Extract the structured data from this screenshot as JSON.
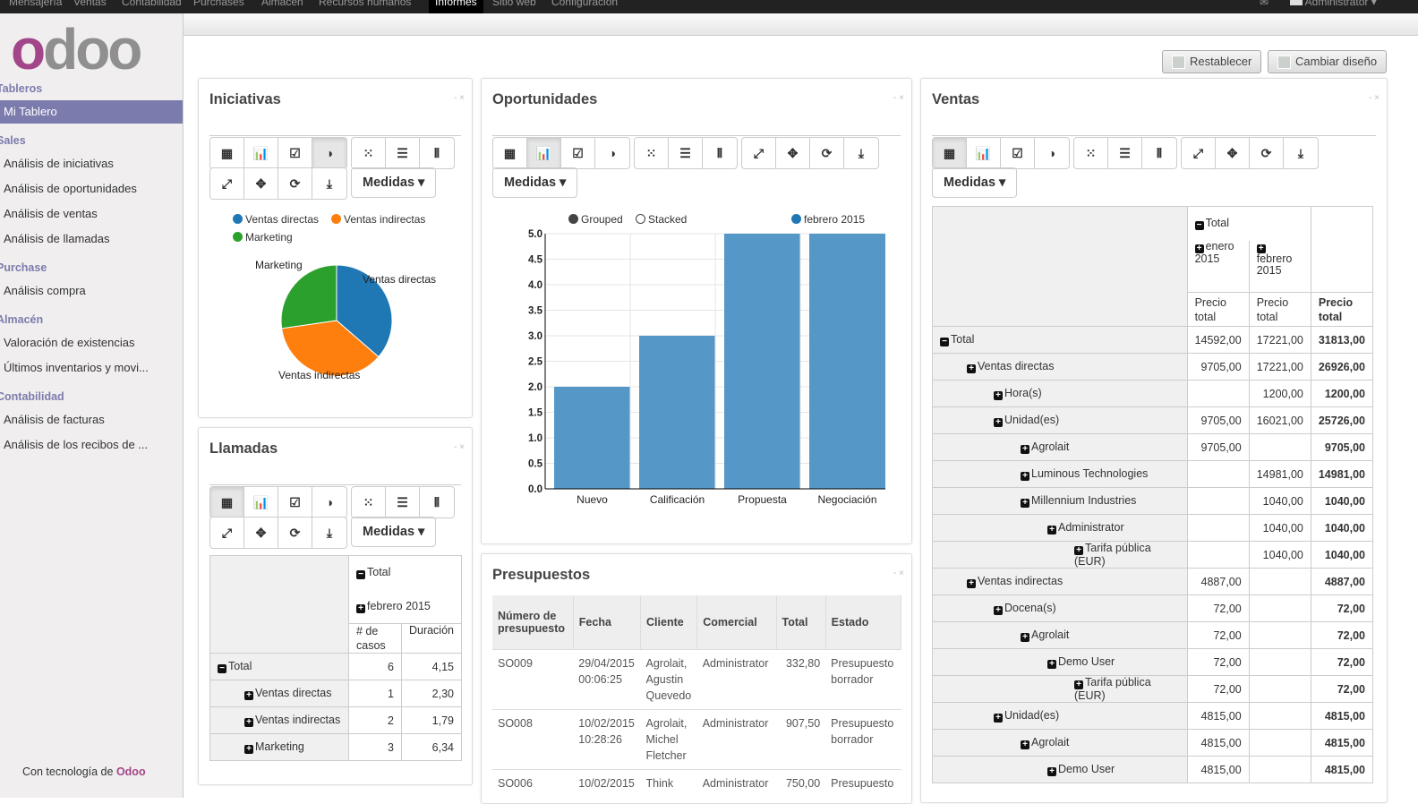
{
  "topnav": {
    "items": [
      "Mensajería",
      "Ventas",
      "Contabilidad",
      "Purchases",
      "Almacén",
      "Recursos humanos",
      "Informes",
      "Sitio web",
      "Configuración"
    ],
    "active": "Informes",
    "user": "Administrator"
  },
  "sidebar": {
    "logo": "odoo",
    "sections": [
      {
        "title": "Tableros",
        "items": [
          "Mi Tablero"
        ]
      },
      {
        "title": "Sales",
        "items": [
          "Análisis de iniciativas",
          "Análisis de oportunidades",
          "Análisis de ventas",
          "Análisis de llamadas"
        ]
      },
      {
        "title": "Purchase",
        "items": [
          "Análisis compra"
        ]
      },
      {
        "title": "Almacén",
        "items": [
          "Valoración de existencias",
          "Últimos inventarios y movi..."
        ]
      },
      {
        "title": "Contabilidad",
        "items": [
          "Análisis de facturas",
          "Análisis de los recibos de ..."
        ]
      }
    ],
    "active": "Mi Tablero",
    "powered_prefix": "Con tecnología de",
    "powered_brand": "Odoo"
  },
  "actions": {
    "reset": "Restablecer",
    "layout": "Cambiar diseño"
  },
  "panel_controls": "- ×",
  "measures_label": "Medidas",
  "colors": {
    "blue": "#1f77b4",
    "orange": "#ff7f0e",
    "green": "#2ca02c",
    "bar": "#5598c8",
    "accent": "#7c7bad",
    "brand": "#a24689"
  },
  "iniciativas": {
    "title": "Iniciativas",
    "active_view": "pie",
    "chart_data": {
      "type": "pie",
      "labels": [
        "Ventas directas",
        "Ventas indirectas",
        "Marketing"
      ],
      "values": [
        4,
        4,
        3
      ],
      "legend": "top"
    }
  },
  "oportunidades": {
    "title": "Oportunidades",
    "active_view": "bar",
    "chart_data": {
      "type": "bar",
      "categories": [
        "Nuevo",
        "Calificación",
        "Propuesta",
        "Negociación"
      ],
      "series": [
        {
          "name": "febrero 2015",
          "values": [
            2,
            3,
            5,
            5
          ]
        }
      ],
      "ylim": [
        0,
        5
      ],
      "yticks": [
        "0.0",
        "0.5",
        "1.0",
        "1.5",
        "2.0",
        "2.5",
        "3.0",
        "3.5",
        "4.0",
        "4.5",
        "5.0"
      ],
      "modes": [
        "Grouped",
        "Stacked"
      ],
      "mode": "Grouped",
      "grid": true
    }
  },
  "llamadas": {
    "title": "Llamadas",
    "active_view": "table",
    "header_total": "Total",
    "header_period": "febrero 2015",
    "col1": "# de casos",
    "col2": "Duración",
    "rows": [
      {
        "label": "Total",
        "expanded": true,
        "indent": 0,
        "v1": "6",
        "v2": "4,15"
      },
      {
        "label": "Ventas directas",
        "indent": 1,
        "v1": "1",
        "v2": "2,30"
      },
      {
        "label": "Ventas indirectas",
        "indent": 1,
        "v1": "2",
        "v2": "1,79"
      },
      {
        "label": "Marketing",
        "indent": 1,
        "v1": "3",
        "v2": "6,34"
      }
    ]
  },
  "presupuestos": {
    "title": "Presupuestos",
    "columns": [
      "Número de presupuesto",
      "Fecha",
      "Cliente",
      "Comercial",
      "Total",
      "Estado"
    ],
    "rows": [
      [
        "SO009",
        "29/04/2015 00:06:25",
        "Agrolait, Agustin Quevedo",
        "Administrator",
        "332,80",
        "Presupuesto borrador"
      ],
      [
        "SO008",
        "10/02/2015 10:28:26",
        "Agrolait, Michel Fletcher",
        "Administrator",
        "907,50",
        "Presupuesto borrador"
      ],
      [
        "SO006",
        "10/02/2015",
        "Think",
        "Administrator",
        "750,00",
        "Presupuesto"
      ]
    ]
  },
  "ventas": {
    "title": "Ventas",
    "active_view": "table",
    "header_total": "Total",
    "periods": [
      "enero 2015",
      "febrero 2015"
    ],
    "measure": "Precio total",
    "rows": [
      {
        "label": "Total",
        "indent": 0,
        "expanded": true,
        "a": "14592,00",
        "b": "17221,00",
        "t": "31813,00"
      },
      {
        "label": "Ventas directas",
        "indent": 1,
        "a": "9705,00",
        "b": "17221,00",
        "t": "26926,00"
      },
      {
        "label": "Hora(s)",
        "indent": 2,
        "a": "",
        "b": "1200,00",
        "t": "1200,00"
      },
      {
        "label": "Unidad(es)",
        "indent": 2,
        "a": "9705,00",
        "b": "16021,00",
        "t": "25726,00"
      },
      {
        "label": "Agrolait",
        "indent": 3,
        "a": "9705,00",
        "b": "",
        "t": "9705,00"
      },
      {
        "label": "Luminous Technologies",
        "indent": 3,
        "a": "",
        "b": "14981,00",
        "t": "14981,00"
      },
      {
        "label": "Millennium Industries",
        "indent": 3,
        "a": "",
        "b": "1040,00",
        "t": "1040,00"
      },
      {
        "label": "Administrator",
        "indent": 4,
        "a": "",
        "b": "1040,00",
        "t": "1040,00"
      },
      {
        "label": "Tarifa pública (EUR)",
        "indent": 5,
        "a": "",
        "b": "1040,00",
        "t": "1040,00"
      },
      {
        "label": "Ventas indirectas",
        "indent": 1,
        "a": "4887,00",
        "b": "",
        "t": "4887,00"
      },
      {
        "label": "Docena(s)",
        "indent": 2,
        "a": "72,00",
        "b": "",
        "t": "72,00"
      },
      {
        "label": "Agrolait",
        "indent": 3,
        "a": "72,00",
        "b": "",
        "t": "72,00"
      },
      {
        "label": "Demo User",
        "indent": 4,
        "a": "72,00",
        "b": "",
        "t": "72,00"
      },
      {
        "label": "Tarifa pública (EUR)",
        "indent": 5,
        "a": "72,00",
        "b": "",
        "t": "72,00"
      },
      {
        "label": "Unidad(es)",
        "indent": 2,
        "a": "4815,00",
        "b": "",
        "t": "4815,00"
      },
      {
        "label": "Agrolait",
        "indent": 3,
        "a": "4815,00",
        "b": "",
        "t": "4815,00"
      },
      {
        "label": "Demo User",
        "indent": 4,
        "a": "4815,00",
        "b": "",
        "t": "4815,00"
      }
    ]
  }
}
